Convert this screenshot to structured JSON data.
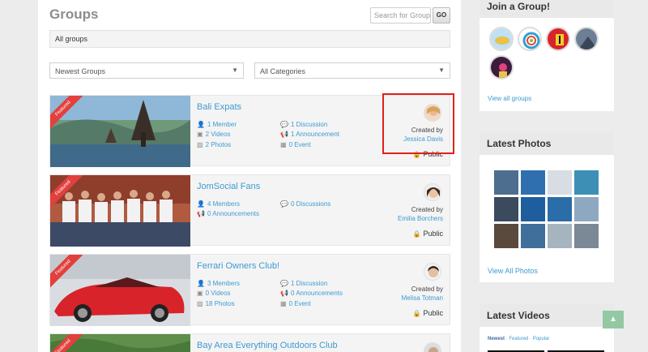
{
  "page": {
    "title": "Groups",
    "search_placeholder": "Search for Group",
    "go_label": "GO",
    "breadcrumb": "All groups"
  },
  "filters": {
    "sort": "Newest Groups",
    "category": "All Categories"
  },
  "groups": [
    {
      "name": "Bali Expats",
      "featured": "Featured",
      "members": "1 Member",
      "videos": "2 Videos",
      "photos": "2 Photos",
      "discussions": "1 Discussion",
      "announcements": "1 Announcement",
      "events": "0 Event",
      "created_by_label": "Created by",
      "creator": "Jessica Davis",
      "privacy": "Public"
    },
    {
      "name": "JomSocial Fans",
      "featured": "Featured",
      "members": "4 Members",
      "announcements_left": "0 Announcements",
      "discussions": "0 Discussions",
      "created_by_label": "Created by",
      "creator": "Emilia Borchers",
      "privacy": "Public"
    },
    {
      "name": "Ferrari Owners Club!",
      "featured": "Featured",
      "members": "3 Members",
      "videos": "0 Videos",
      "photos": "18 Photos",
      "discussions": "1 Discussion",
      "announcements": "0 Announcements",
      "events": "0 Event",
      "created_by_label": "Created by",
      "creator": "Melisa Totman",
      "privacy": "Public"
    },
    {
      "name": "Bay Area Everything Outdoors Club",
      "featured": "Featured"
    }
  ],
  "sidebar": {
    "join": {
      "title": "Join a Group!",
      "link": "View all groups"
    },
    "photos": {
      "title": "Latest Photos",
      "link": "View All Photos"
    },
    "videos": {
      "title": "Latest Videos",
      "tab_newest": "Newest",
      "sep1": "·",
      "tab_featured": "Featured",
      "sep2": "·",
      "tab_popular": "Popular"
    }
  },
  "icons": {
    "members": "user-icon",
    "videos": "video-icon",
    "photos": "image-icon",
    "discussions": "chat-icon",
    "announcements": "megaphone-icon",
    "events": "calendar-icon",
    "privacy": "lock-icon",
    "scroll": "chevron-up-icon"
  },
  "colors": {
    "link": "#3d9bd1",
    "featured": "#e2403d",
    "highlight": "#e0201b",
    "panel": "#f4f4f4"
  }
}
